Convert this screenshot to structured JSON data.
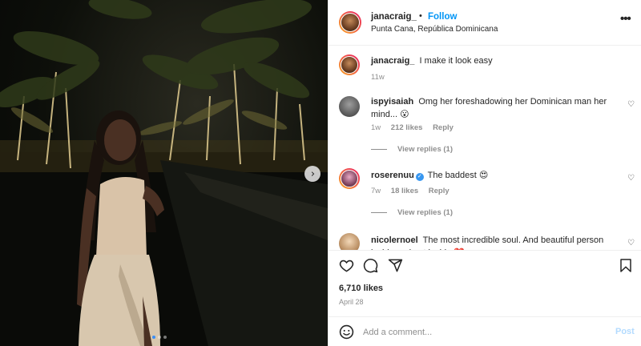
{
  "post": {
    "author": "janacraig_",
    "follow_label": "Follow",
    "separator": "•",
    "location": "Punta Cana, República Dominicana",
    "more_label": "•••",
    "next_label": "›"
  },
  "comments": [
    {
      "username": "janacraig_",
      "text": "I make it look easy",
      "time": "11w",
      "is_caption": true
    },
    {
      "username": "ispyisaiah",
      "text": "Omg her foreshadowing her Dominican man her mind... 😮",
      "time": "1w",
      "likes": "212 likes",
      "reply_label": "Reply",
      "view_replies": "View replies (1)"
    },
    {
      "username": "roserenuu",
      "verified": true,
      "text": "The baddest 😍",
      "time": "7w",
      "likes": "18 likes",
      "reply_label": "Reply",
      "view_replies": "View replies (1)"
    },
    {
      "username": "nicolernoel",
      "text": "The most incredible soul. And beautiful person inside and out inside ❤️",
      "time": "",
      "likes": ""
    }
  ],
  "stats": {
    "likes": "6,710 likes",
    "date": "April 28"
  },
  "composer": {
    "placeholder": "Add a comment...",
    "post_label": "Post"
  },
  "icons": [
    "more-icon",
    "next-image-icon",
    "heart-icon",
    "comment-icon",
    "share-icon",
    "bookmark-icon",
    "emoji-icon",
    "verified-icon"
  ],
  "colors": {
    "link_blue": "#0095f6",
    "post_disabled": "#b3dbff",
    "muted_text": "#8e8e8e",
    "active_dot": "#3a8ef6"
  }
}
